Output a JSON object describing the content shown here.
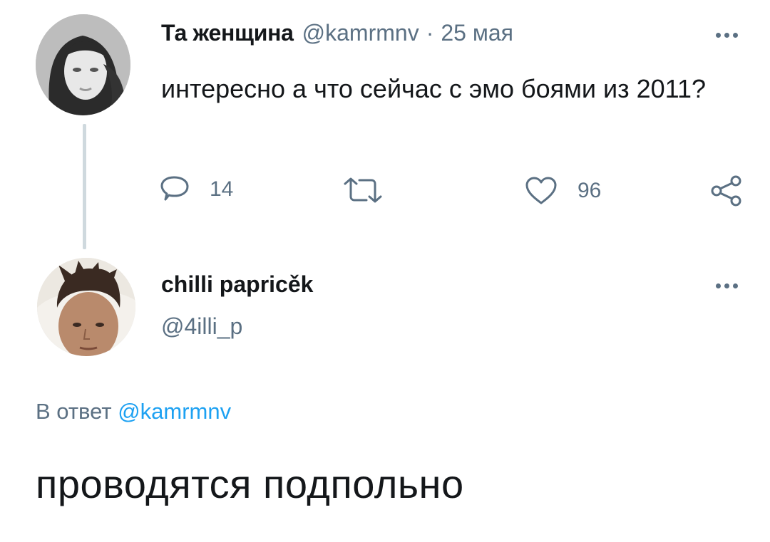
{
  "parent_tweet": {
    "author_name": "Та женщина",
    "author_handle": "@kamrmnv",
    "separator": "·",
    "date": "25 мая",
    "text": "интересно а что сейчас с эмо боями из 2011?",
    "actions": {
      "reply_count": "14",
      "retweet_count": "",
      "like_count": "96"
    }
  },
  "reply_tweet": {
    "author_name": "chilli papricěk",
    "author_handle": "@4illi_p",
    "reply_to_prefix": "В ответ",
    "reply_to_handle": "@kamrmnv",
    "text": "проводятся подпольно"
  },
  "colors": {
    "text_primary": "#14171a",
    "text_secondary": "#5b7083",
    "link": "#1da1f2",
    "thread_line": "#cfd9de"
  },
  "icons": {
    "reply": "speech-bubble-icon",
    "retweet": "retweet-arrows-icon",
    "like": "heart-icon",
    "share": "share-nodes-icon",
    "more": "three-dots-icon"
  }
}
